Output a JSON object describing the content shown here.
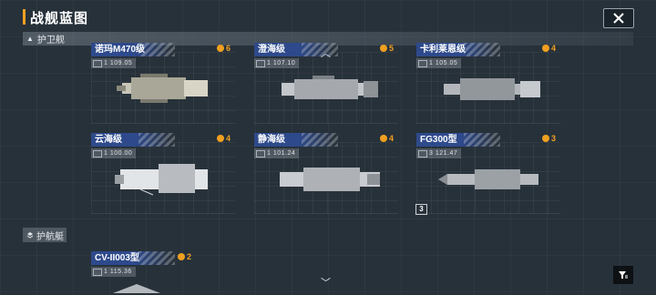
{
  "title": "战舰蓝图",
  "sections": {
    "frigate": "护卫舰",
    "escort": "护航艇"
  },
  "frigates": [
    {
      "name": "诺玛M470级",
      "cost": "6",
      "stats": "1 109.05"
    },
    {
      "name": "澄海级",
      "cost": "5",
      "stats": "1 107.10"
    },
    {
      "name": "卡利莱恩级",
      "cost": "4",
      "stats": "1 105.05"
    },
    {
      "name": "云海级",
      "cost": "4",
      "stats": "1 100.00"
    },
    {
      "name": "静海级",
      "cost": "4",
      "stats": "1 101.24"
    },
    {
      "name": "FG300型",
      "cost": "3",
      "stats": "3 121.47"
    }
  ],
  "escorts": [
    {
      "name": "CV-II003型",
      "cost": "2",
      "stats": "1 115.36"
    }
  ],
  "tag_3": "3",
  "colors": {
    "accent": "#f0a020",
    "name_bar": "#2e4a8c",
    "background": "#27313a"
  },
  "icons": {
    "close": "close-icon",
    "filter": "filter-icon",
    "scroll_up": "chevron-up-icon",
    "scroll_down": "chevron-down-icon"
  }
}
